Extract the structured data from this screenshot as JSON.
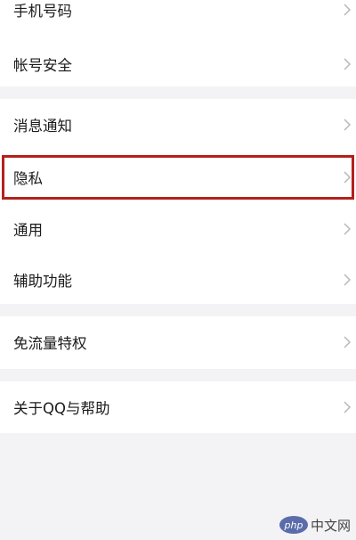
{
  "settings": {
    "rows": [
      {
        "label": "手机号码"
      },
      {
        "label": "帐号安全"
      },
      {
        "label": "消息通知"
      },
      {
        "label": "隐私"
      },
      {
        "label": "通用"
      },
      {
        "label": "辅助功能"
      },
      {
        "label": "免流量特权"
      },
      {
        "label": "关于QQ与帮助"
      }
    ],
    "chevron_icon": "chevron-right-icon"
  },
  "watermark": {
    "logo_text": "php",
    "site_text": "中文网"
  },
  "colors": {
    "background": "#f3f3f5",
    "card": "#ffffff",
    "text": "#1b1b1b",
    "chevron": "#b9b9b9",
    "highlight": "#b5201b"
  }
}
